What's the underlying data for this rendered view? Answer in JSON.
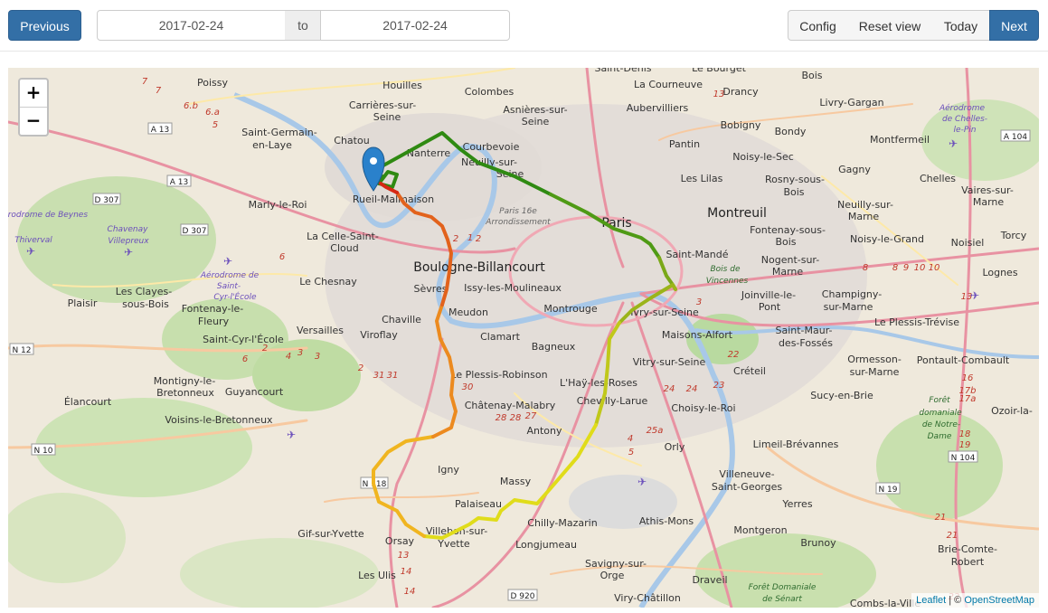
{
  "toolbar": {
    "previous_label": "Previous",
    "date_from": "2017-02-24",
    "separator": "to",
    "date_to": "2017-02-24",
    "config_label": "Config",
    "reset_view_label": "Reset view",
    "today_label": "Today",
    "next_label": "Next"
  },
  "map": {
    "zoom_in": "+",
    "zoom_out": "−",
    "attribution": {
      "leaflet": "Leaflet",
      "separator": " | © ",
      "osm": "OpenStreetMap"
    },
    "colors": {
      "accent": "#336fa6",
      "track_green": "#3a8c1a",
      "track_yellow": "#e8e81a",
      "track_orange": "#f0a020",
      "track_red": "#d62814",
      "marker": "#2a81cb"
    },
    "places": [
      "Saint-Denis",
      "Le Bourget",
      "Bois",
      "Poissy",
      "Houilles",
      "Colombes",
      "La Courneuve",
      "Drancy",
      "Livry-Gargan",
      "Carrières-sur-",
      "Seine",
      "Asnières-sur-",
      "Seine",
      "Aubervilliers",
      "Bobigny",
      "Bondy",
      "Aérodrome",
      "de Chelles-",
      "le-Pin",
      "Saint-Germain-",
      "en-Laye",
      "Chatou",
      "Nanterre",
      "Courbevoie",
      "Neuilly-sur-",
      "Seine",
      "Pantin",
      "Noisy-le-Sec",
      "Montfermeil",
      "Les Lilas",
      "Rosny-sous-",
      "Bois",
      "Gagny",
      "Chelles",
      "Vaires-sur-",
      "Marne",
      "Marly-le-Roi",
      "Rueil-Malmaison",
      "Paris 16e",
      "Arrondissement",
      "Paris",
      "Montreuil",
      "Neuilly-sur-",
      "Marne",
      "Aérodrome de Beynes",
      "Thiverval",
      "Chavenay",
      "Villepreux",
      "La Celle-Saint-",
      "Cloud",
      "Fontenay-sous-",
      "Bois",
      "Noisy-le-Grand",
      "Noisiel",
      "Torcy",
      "Saint-Mandé",
      "Bois de",
      "Vincennes",
      "Nogent-sur-",
      "Marne",
      "Lognes",
      "Boulogne-Billancourt",
      "Le Chesnay",
      "Sèvres",
      "Issy-les-Moulineaux",
      "Aérodrome de",
      "Saint-",
      "Cyr-l'École",
      "Plaisir",
      "Les Clayes-",
      "sous-Bois",
      "Fontenay-le-",
      "Fleury",
      "Champigny-",
      "sur-Marne",
      "Joinville-le-",
      "Pont",
      "Meudon",
      "Montrouge",
      "Ivry-sur-Seine",
      "Chaville",
      "Viroflay",
      "Versailles",
      "Clamart",
      "Maisons-Alfort",
      "Saint-Maur-",
      "des-Fossés",
      "Le Plessis-Trévise",
      "Saint-Cyr-l'École",
      "Bagneux",
      "Créteil",
      "Ormesson-",
      "sur-Marne",
      "Pontault-Combault",
      "Montigny-le-",
      "Bretonneux",
      "Guyancourt",
      "Élancourt",
      "Le Plessis-Robinson",
      "L'Haÿ-les-Roses",
      "Vitry-sur-Seine",
      "Sucy-en-Brie",
      "Châtenay-Malabry",
      "Chevilly-Larue",
      "Choisy-le-Roi",
      "Forêt",
      "domaniale",
      "de Notre-",
      "Dame",
      "Ozoir-la-",
      "Voisins-le-Bretonneux",
      "Antony",
      "Orly",
      "Limeil-Brévannes",
      "Igny",
      "Massy",
      "Villeneuve-",
      "Saint-Georges",
      "Palaiseau",
      "Chilly-Mazarin",
      "Athis-Mons",
      "Yerres",
      "Gif-sur-Yvette",
      "Orsay",
      "Villebon-sur-",
      "Yvette",
      "Longjumeau",
      "Montgeron",
      "Brunoy",
      "Brie-Comte-",
      "Robert",
      "Les Ulis",
      "Savigny-sur-",
      "Orge",
      "Draveil",
      "Viry-Châtillon",
      "Forêt Domaniale",
      "de Sénart",
      "Combs-la-Ville"
    ],
    "roads": [
      "A 13",
      "A 13",
      "D 307",
      "D 307",
      "N 12",
      "N 10",
      "N 118",
      "N 104",
      "N 19",
      "N 104",
      "D 920",
      "A 104"
    ],
    "exit_numbers": [
      "7",
      "7",
      "6.b",
      "6.a",
      "5",
      "6",
      "2",
      "1",
      "2",
      "2",
      "8",
      "6",
      "4",
      "3",
      "3",
      "3",
      "2",
      "31",
      "31",
      "30",
      "28",
      "28",
      "27",
      "25a",
      "24",
      "24",
      "23",
      "22",
      "21",
      "21",
      "22",
      "17b",
      "17a",
      "16",
      "18",
      "19",
      "13",
      "13",
      "8",
      "9",
      "10",
      "10",
      "14",
      "14",
      "13",
      "4",
      "5"
    ]
  }
}
